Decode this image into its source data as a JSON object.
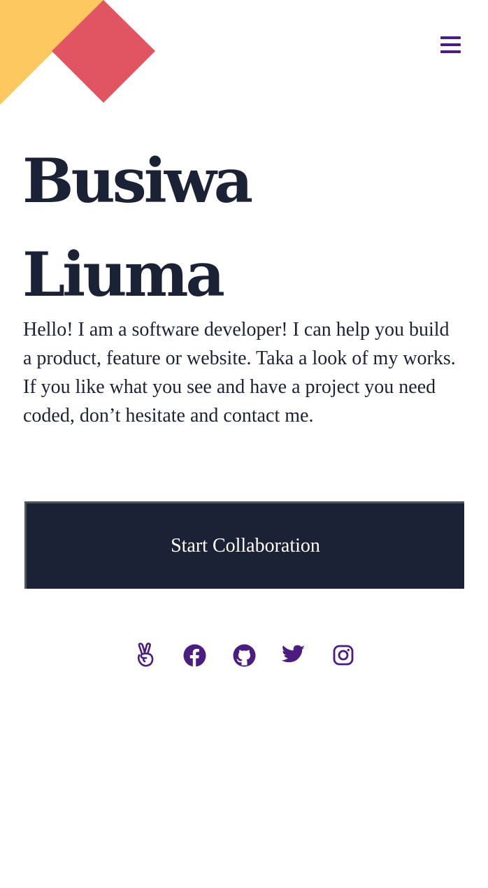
{
  "header": {
    "menu_icon": "hamburger-menu-icon"
  },
  "hero": {
    "name_line1": "Busiwa",
    "name_line2": "Liuma",
    "bio": "Hello! I am a software developer! I can help you build a product, feature or website. Taka a look of my works. If you like what you see and have a project you need coded, don’t hesitate and contact me.",
    "cta_label": "Start Collaboration"
  },
  "socials": [
    {
      "icon": "angellist-icon"
    },
    {
      "icon": "facebook-icon"
    },
    {
      "icon": "github-icon"
    },
    {
      "icon": "twitter-icon"
    },
    {
      "icon": "instagram-icon"
    }
  ],
  "colors": {
    "accent_purple": "#4c1d80",
    "dark_navy": "#1c2235",
    "decor_yellow": "#fec860",
    "decor_red": "#e15562"
  }
}
